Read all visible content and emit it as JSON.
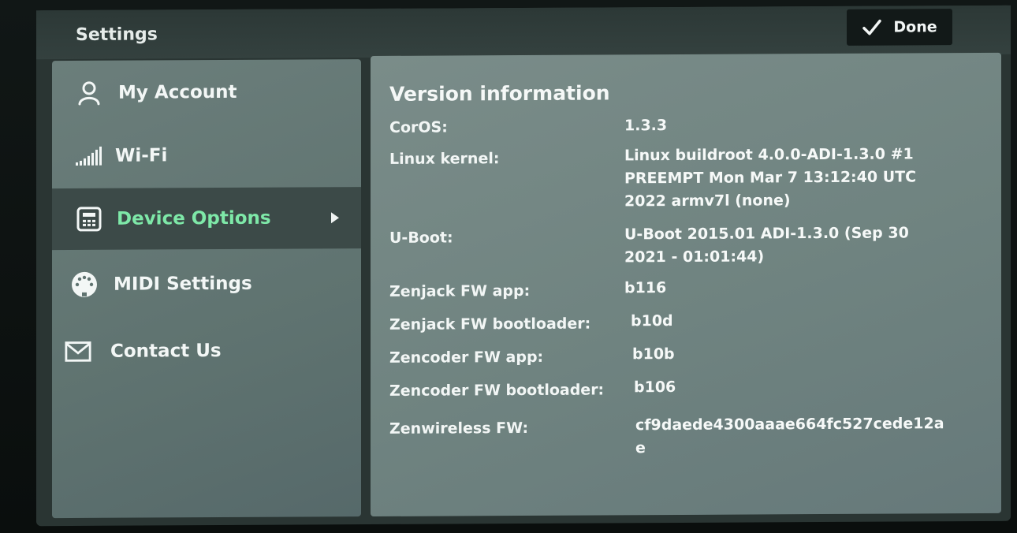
{
  "header": {
    "title": "Settings",
    "done_label": "Done"
  },
  "sidebar": {
    "items": [
      {
        "label": "My Account",
        "icon": "user-icon"
      },
      {
        "label": "Wi-Fi",
        "icon": "signal-bars-icon"
      },
      {
        "label": "Device Options",
        "icon": "device-icon",
        "active": true
      },
      {
        "label": "MIDI Settings",
        "icon": "midi-connector-icon"
      },
      {
        "label": "Contact Us",
        "icon": "envelope-icon"
      }
    ]
  },
  "version_info": {
    "title": "Version information",
    "rows": [
      {
        "key": "CorOS:",
        "value": "1.3.3"
      },
      {
        "key": "Linux kernel:",
        "value": "Linux buildroot 4.0.0-ADI-1.3.0 #1 PREEMPT Mon Mar 7 13:12:40 UTC 2022 armv7l (none)"
      },
      {
        "key": "U-Boot:",
        "value": "U-Boot 2015.01 ADI-1.3.0 (Sep 30 2021 - 01:01:44)"
      },
      {
        "key": "Zenjack FW app:",
        "value": "b116"
      },
      {
        "key": "Zenjack FW bootloader:",
        "value": "b10d"
      },
      {
        "key": "Zencoder FW app:",
        "value": "b10b"
      },
      {
        "key": "Zencoder FW bootloader:",
        "value": "b106"
      },
      {
        "key": "Zenwireless FW:",
        "value": "cf9daede4300aaae664fc527cede12ae"
      }
    ]
  },
  "colors": {
    "active_text": "#7ee8a8",
    "active_bg": "#3c4a48"
  }
}
